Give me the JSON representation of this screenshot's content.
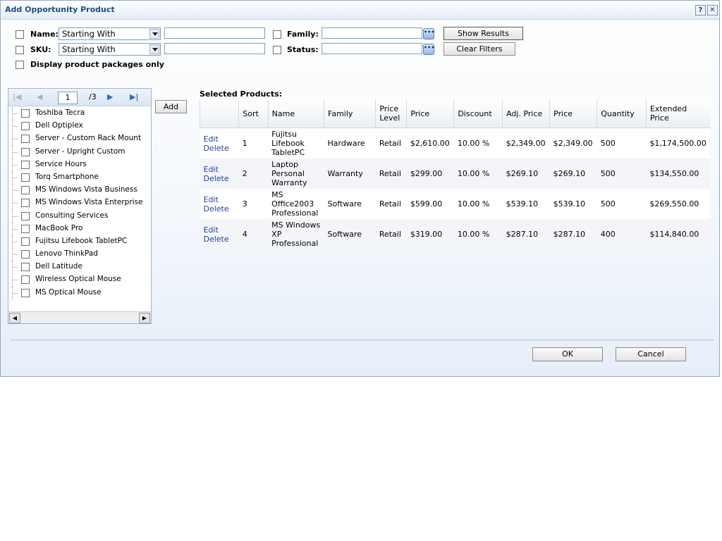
{
  "dialog": {
    "title": "Add Opportunity Product",
    "help_label": "?",
    "close_label": "✕"
  },
  "filters": {
    "name_label": "Name:",
    "name_operator": "Starting With",
    "name_value": "",
    "sku_label": "SKU:",
    "sku_operator": "Starting With",
    "sku_value": "",
    "family_label": "Family:",
    "family_value": "",
    "status_label": "Status:",
    "status_value": "",
    "lookup_glyph": "•••",
    "packages_label": "Display product packages only",
    "show_results": "Show Results",
    "clear_filters": "Clear Filters"
  },
  "pager": {
    "first": "|◀",
    "prev": "◀",
    "page": "1",
    "total": "/3",
    "next": "▶",
    "last": "▶|"
  },
  "products": [
    "Toshiba Tecra",
    "Dell Optiplex",
    "Server - Custom Rack Mount",
    "Server - Upright Custom",
    "Service Hours",
    "Torq Smartphone",
    "MS Windows Vista Business",
    "MS Windows Vista Enterprise",
    "Consulting Services",
    "MacBook Pro",
    "Fujitsu Lifebook TabletPC",
    "Lenovo ThinkPad",
    "Dell Latitude",
    "Wireless Optical Mouse",
    "MS Optical Mouse"
  ],
  "add_button": "Add",
  "selected": {
    "heading": "Selected Products:",
    "columns": [
      "",
      "Sort",
      "Name",
      "Family",
      "Price Level",
      "Price",
      "Discount",
      "Adj. Price",
      "Price",
      "Quantity",
      "Extended Price"
    ],
    "edit_label": "Edit",
    "delete_label": "Delete",
    "rows": [
      {
        "sort": "1",
        "name": "Fujitsu Lifebook TabletPC",
        "family": "Hardware",
        "level": "Retail",
        "price": "$2,610.00",
        "discount": "10.00 %",
        "adj": "$2,349.00",
        "price2": "$2,349.00",
        "qty": "500",
        "ext": "$1,174,500.00"
      },
      {
        "sort": "2",
        "name": "Laptop Personal Warranty",
        "family": "Warranty",
        "level": "Retail",
        "price": "$299.00",
        "discount": "10.00 %",
        "adj": "$269.10",
        "price2": "$269.10",
        "qty": "500",
        "ext": "$134,550.00"
      },
      {
        "sort": "3",
        "name": "MS Office2003 Professional",
        "family": "Software",
        "level": "Retail",
        "price": "$599.00",
        "discount": "10.00 %",
        "adj": "$539.10",
        "price2": "$539.10",
        "qty": "500",
        "ext": "$269,550.00"
      },
      {
        "sort": "4",
        "name": "MS Windows XP Professional",
        "family": "Software",
        "level": "Retail",
        "price": "$319.00",
        "discount": "10.00 %",
        "adj": "$287.10",
        "price2": "$287.10",
        "qty": "400",
        "ext": "$114,840.00"
      }
    ]
  },
  "footer": {
    "ok": "OK",
    "cancel": "Cancel"
  }
}
